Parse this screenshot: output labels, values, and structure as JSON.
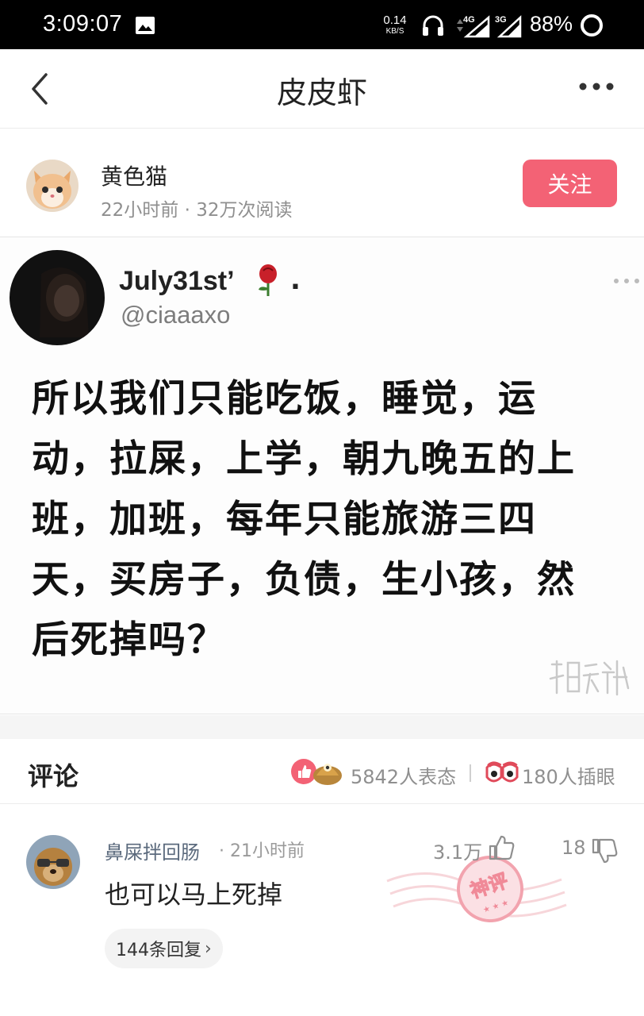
{
  "status_bar": {
    "time": "3:09:07",
    "net_speed_value": "0.14",
    "net_speed_unit": "KB/S",
    "signal_1": "4G",
    "signal_2": "3G",
    "battery": "88%"
  },
  "nav": {
    "title": "皮皮虾"
  },
  "author": {
    "name": "黄色猫",
    "meta": "22小时前 · 32万次阅读",
    "follow_label": "关注"
  },
  "post": {
    "tweet_name": "July31st’",
    "tweet_name_suffix": ".",
    "tweet_handle": "@ciaaaxo",
    "tweet_text": "所以我们只能吃饭，睡觉，运动，拉屎，上学，朝九晚五的上班，加班，每年只能旅游三四天，买房子，负债，生小孩，然后死掉吗？"
  },
  "comments_section": {
    "label": "评论",
    "reactions": "5842人表态",
    "views": "180人插眼"
  },
  "comment": {
    "user": "鼻屎拌回肠",
    "time": "· 21小时前",
    "likes": "3.1万",
    "dislikes": "18",
    "text": "也可以马上死掉",
    "replies_label": "144条回复",
    "badge_text": "神评"
  },
  "colors": {
    "accent": "#f36275",
    "status_bar_bg": "#000000",
    "username": "#5b6a7d"
  }
}
